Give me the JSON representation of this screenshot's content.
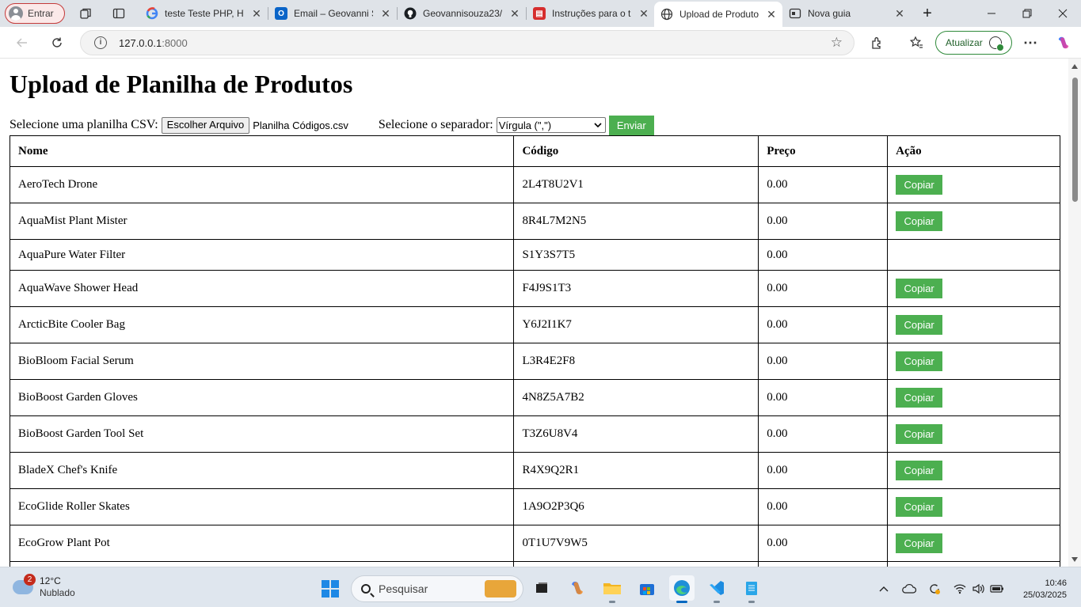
{
  "browser": {
    "profile_label": "Entrar",
    "tabs": [
      {
        "title": "teste Teste PHP, HT",
        "icon": "google-icon"
      },
      {
        "title": "Email – Geovanni S",
        "icon": "outlook-icon"
      },
      {
        "title": "Geovannisouza23/",
        "icon": "github-icon"
      },
      {
        "title": "Instruções para o t",
        "icon": "pdf-icon"
      },
      {
        "title": "Upload de Produto",
        "icon": "globe-icon",
        "active": true
      },
      {
        "title": "Nova guia",
        "icon": "new-tab-icon"
      }
    ],
    "url_host": "127.0.0.1",
    "url_port": ":8000",
    "update_label": "Atualizar"
  },
  "page": {
    "title": "Upload de Planilha de Produtos",
    "file_label": "Selecione uma planilha CSV:",
    "file_button": "Escolher Arquivo",
    "file_name": "Planilha Códigos.csv",
    "separator_label": "Selecione o separador:",
    "separator_value": "Vírgula (\",\")",
    "submit_label": "Enviar",
    "copy_label": "Copiar",
    "headers": [
      "Nome",
      "Código",
      "Preço",
      "Ação"
    ],
    "rows": [
      {
        "name": "AeroTech Drone",
        "code": "2L4T8U2V1",
        "price": "0.00",
        "copy": true
      },
      {
        "name": "AquaMist Plant Mister",
        "code": "8R4L7M2N5",
        "price": "0.00",
        "copy": true
      },
      {
        "name": "AquaPure Water Filter",
        "code": "S1Y3S7T5",
        "price": "0.00",
        "copy": false
      },
      {
        "name": "AquaWave Shower Head",
        "code": "F4J9S1T3",
        "price": "0.00",
        "copy": true
      },
      {
        "name": "ArcticBite Cooler Bag",
        "code": "Y6J2I1K7",
        "price": "0.00",
        "copy": true
      },
      {
        "name": "BioBloom Facial Serum",
        "code": "L3R4E2F8",
        "price": "0.00",
        "copy": true
      },
      {
        "name": "BioBoost Garden Gloves",
        "code": "4N8Z5A7B2",
        "price": "0.00",
        "copy": true
      },
      {
        "name": "BioBoost Garden Tool Set",
        "code": "T3Z6U8V4",
        "price": "0.00",
        "copy": true
      },
      {
        "name": "BladeX Chef's Knife",
        "code": "R4X9Q2R1",
        "price": "0.00",
        "copy": true
      },
      {
        "name": "EcoGlide Roller Skates",
        "code": "1A9O2P3Q6",
        "price": "0.00",
        "copy": true
      },
      {
        "name": "EcoGrow Plant Pot",
        "code": "0T1U7V9W5",
        "price": "0.00",
        "copy": true
      },
      {
        "name": "",
        "code": "",
        "price": "",
        "copy": false
      }
    ]
  },
  "taskbar": {
    "weather_badge": "2",
    "temperature": "12°C",
    "condition": "Nublado",
    "search_placeholder": "Pesquisar",
    "time": "10:46",
    "date": "25/03/2025"
  },
  "colors": {
    "accent_green": "#4caf50",
    "profile_red": "#c43a3a",
    "windows_blue": "#0067c0"
  }
}
